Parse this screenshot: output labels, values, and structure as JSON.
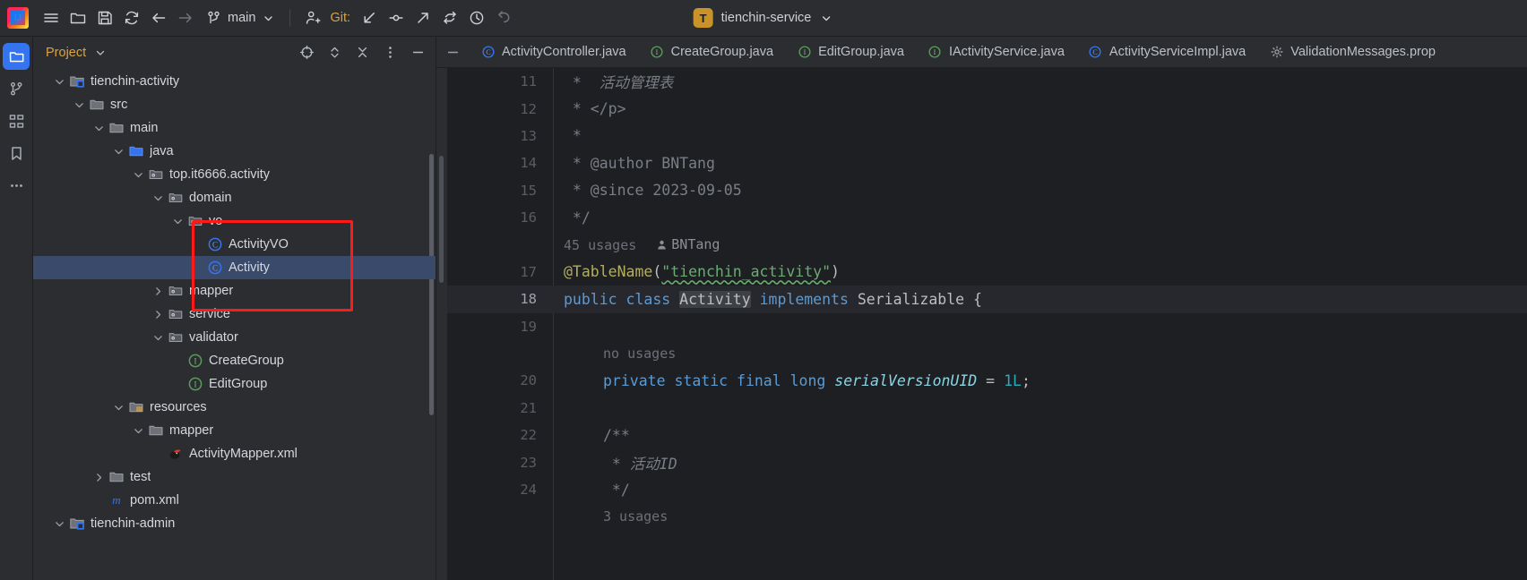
{
  "window": {
    "run_configuration": "tienchin-service",
    "run_badge_letter": "T",
    "git_label": "Git:",
    "branch": "main"
  },
  "toolbar": {
    "icons": [
      {
        "name": "main-menu-icon",
        "glyph": "hamburger"
      },
      {
        "name": "open-folder-icon",
        "glyph": "folder"
      },
      {
        "name": "save-all-icon",
        "glyph": "floppy"
      },
      {
        "name": "reload-from-disk-icon",
        "glyph": "refresh"
      },
      {
        "name": "navigate-back-icon",
        "glyph": "arrow-left"
      },
      {
        "name": "navigate-forward-icon",
        "glyph": "arrow-right"
      }
    ],
    "git_icons": [
      {
        "name": "git-update-project-icon",
        "glyph": "arrow-down-left"
      },
      {
        "name": "git-commit-icon",
        "glyph": "commit-dot"
      },
      {
        "name": "git-push-icon",
        "glyph": "arrow-up-right"
      },
      {
        "name": "git-pull-requests-icon",
        "glyph": "merge-arrows"
      },
      {
        "name": "git-history-icon",
        "glyph": "clock"
      },
      {
        "name": "git-rollback-icon",
        "glyph": "undo"
      }
    ],
    "add-user-icon": "add-user"
  },
  "stripe": {
    "buttons": [
      {
        "name": "tool-window-project",
        "icon": "folder-icon",
        "active": true
      },
      {
        "name": "tool-window-commit",
        "icon": "commit-icon",
        "active": false
      },
      {
        "name": "tool-window-structure",
        "icon": "structure-icon",
        "active": false
      },
      {
        "name": "tool-window-bookmarks",
        "icon": "bookmark-icon",
        "active": false
      },
      {
        "name": "tool-window-more",
        "icon": "more-icon",
        "active": false
      }
    ]
  },
  "project_panel": {
    "title": "Project",
    "header_buttons": [
      {
        "name": "select-opened-file-button",
        "icon": "crosshair-icon"
      },
      {
        "name": "expand-collapse-button",
        "icon": "chevrons-updown-icon"
      },
      {
        "name": "collapse-all-button",
        "icon": "collapse-all-icon"
      },
      {
        "name": "panel-options-button",
        "icon": "more-vertical-icon"
      },
      {
        "name": "hide-panel-button",
        "icon": "minimize-icon"
      }
    ],
    "tree": [
      {
        "label": "tienchin-activity",
        "depth": 1,
        "arrow": "down",
        "icon": "module-folder",
        "selected": false
      },
      {
        "label": "src",
        "depth": 2,
        "arrow": "down",
        "icon": "folder",
        "selected": false
      },
      {
        "label": "main",
        "depth": 3,
        "arrow": "down",
        "icon": "folder",
        "selected": false
      },
      {
        "label": "java",
        "depth": 4,
        "arrow": "down",
        "icon": "source-folder",
        "selected": false
      },
      {
        "label": "top.it6666.activity",
        "depth": 5,
        "arrow": "down",
        "icon": "package",
        "selected": false
      },
      {
        "label": "domain",
        "depth": 6,
        "arrow": "down",
        "icon": "package",
        "selected": false
      },
      {
        "label": "vo",
        "depth": 7,
        "arrow": "down",
        "icon": "package",
        "selected": false
      },
      {
        "label": "ActivityVO",
        "depth": 8,
        "arrow": "none",
        "icon": "class",
        "selected": false
      },
      {
        "label": "Activity",
        "depth": 8,
        "arrow": "none",
        "icon": "class",
        "selected": true
      },
      {
        "label": "mapper",
        "depth": 6,
        "arrow": "right",
        "icon": "package",
        "selected": false
      },
      {
        "label": "service",
        "depth": 6,
        "arrow": "right",
        "icon": "package",
        "selected": false
      },
      {
        "label": "validator",
        "depth": 6,
        "arrow": "down",
        "icon": "package",
        "selected": false
      },
      {
        "label": "CreateGroup",
        "depth": 7,
        "arrow": "none",
        "icon": "interface",
        "selected": false
      },
      {
        "label": "EditGroup",
        "depth": 7,
        "arrow": "none",
        "icon": "interface",
        "selected": false
      },
      {
        "label": "resources",
        "depth": 4,
        "arrow": "down",
        "icon": "resource-folder",
        "selected": false
      },
      {
        "label": "mapper",
        "depth": 5,
        "arrow": "down",
        "icon": "folder",
        "selected": false
      },
      {
        "label": "ActivityMapper.xml",
        "depth": 6,
        "arrow": "none",
        "icon": "mybatis",
        "selected": false
      },
      {
        "label": "test",
        "depth": 3,
        "arrow": "right",
        "icon": "folder",
        "selected": false
      },
      {
        "label": "pom.xml",
        "depth": 3,
        "arrow": "none",
        "icon": "maven",
        "selected": false
      },
      {
        "label": "tienchin-admin",
        "depth": 1,
        "arrow": "down",
        "icon": "module-folder",
        "selected": false
      }
    ]
  },
  "editor": {
    "tabs": [
      {
        "label": "ActivityController.java",
        "icon": "class",
        "active": false
      },
      {
        "label": "CreateGroup.java",
        "icon": "interface",
        "active": false
      },
      {
        "label": "EditGroup.java",
        "icon": "interface",
        "active": false
      },
      {
        "label": "IActivityService.java",
        "icon": "interface",
        "active": false
      },
      {
        "label": "ActivityServiceImpl.java",
        "icon": "class",
        "active": false
      },
      {
        "label": "ValidationMessages.prop",
        "icon": "settings",
        "active": false
      }
    ],
    "lines": [
      {
        "no": "11",
        "type": "code",
        "current": false
      },
      {
        "no": "12",
        "type": "code",
        "current": false
      },
      {
        "no": "13",
        "type": "code",
        "current": false
      },
      {
        "no": "14",
        "type": "code",
        "current": false
      },
      {
        "no": "15",
        "type": "code",
        "current": false
      },
      {
        "no": "16",
        "type": "code",
        "current": false
      },
      {
        "no": "",
        "type": "hint",
        "current": false
      },
      {
        "no": "17",
        "type": "code",
        "current": false
      },
      {
        "no": "18",
        "type": "code",
        "current": true
      },
      {
        "no": "19",
        "type": "code",
        "current": false
      },
      {
        "no": "",
        "type": "hint",
        "current": false
      },
      {
        "no": "20",
        "type": "code",
        "current": false
      },
      {
        "no": "21",
        "type": "code",
        "current": false
      },
      {
        "no": "22",
        "type": "code",
        "current": false
      },
      {
        "no": "23",
        "type": "code",
        "current": false
      },
      {
        "no": "24",
        "type": "code",
        "current": false
      },
      {
        "no": "",
        "type": "hint",
        "current": false
      }
    ],
    "text": {
      "l11": " *  活动管理表",
      "l12": " * </p>",
      "l13": " *",
      "l14": " * @author BNTang",
      "l15": " * @since 2023-09-05",
      "l16": " */",
      "usages_45": "45 usages",
      "usages_45_author": "BNTang",
      "l17_anno": "@TableName",
      "l17_str": "\"tienchin_activity\"",
      "l18_public": "public",
      "l18_class": "class",
      "l18_name": "Activity",
      "l18_implements": "implements",
      "l18_serializable": "Serializable {",
      "no_usages": "no usages",
      "l20_modifiers": "private static final long",
      "l20_field": "serialVersionUID",
      "l20_value": "1L",
      "l22": "/**",
      "l23": " * 活动ID",
      "l24": " */",
      "usages_3": "3 usages"
    }
  },
  "annotation": {
    "color": "#ff1a1a",
    "label": "highlight-rectangle-domain-vo-activity"
  }
}
